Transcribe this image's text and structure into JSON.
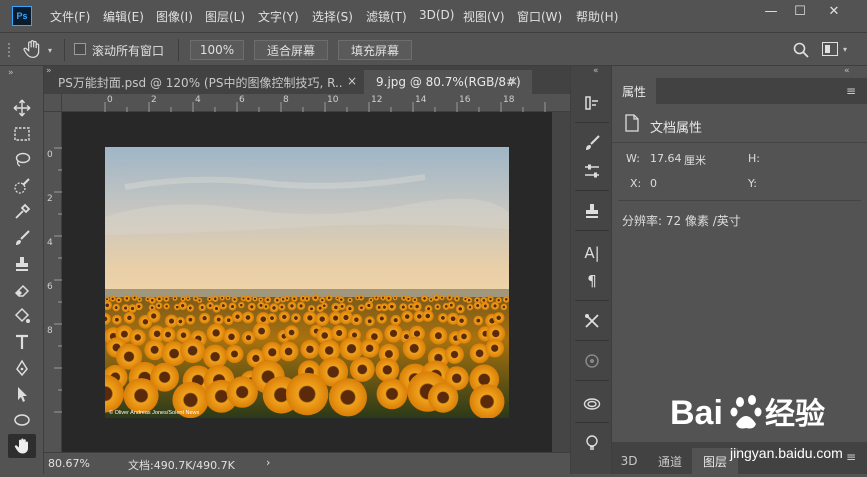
{
  "app": {
    "logo": "Ps"
  },
  "menu": [
    "文件(F)",
    "编辑(E)",
    "图像(I)",
    "图层(L)",
    "文字(Y)",
    "选择(S)",
    "滤镜(T)",
    "3D(D)",
    "视图(V)",
    "窗口(W)",
    "帮助(H)"
  ],
  "window_buttons": {
    "minimize": "—",
    "maximize": "☐",
    "close": "✕"
  },
  "options": {
    "scroll_all_label": "滚动所有窗口",
    "zoom_value": "100%",
    "fit_screen": "适合屏幕",
    "fill_screen": "填充屏幕"
  },
  "tabs": [
    {
      "label": "PS万能封面.psd @ 120% (PS中的图像控制技巧, R...",
      "close": "×"
    },
    {
      "label": "9.jpg @ 80.7%(RGB/8#)",
      "close": "×"
    }
  ],
  "ruler_top": [
    "0",
    "2",
    "4",
    "6",
    "8",
    "10",
    "12",
    "14",
    "16",
    "18"
  ],
  "ruler_left": [
    "0",
    "2",
    "4",
    "6",
    "8"
  ],
  "photo": {
    "credit": "© Oliver Andreas Jones/Solent News"
  },
  "status": {
    "zoom": "80.67%",
    "doc": "文档:490.7K/490.7K",
    "arrow": "›"
  },
  "properties": {
    "tab": "属性",
    "title": "文档属性",
    "w_label": "W:",
    "w_value": "17.64",
    "w_unit": "厘米",
    "h_label": "H:",
    "x_label": "X:",
    "x_value": "0",
    "y_label": "Y:",
    "resolution": "分辨率: 72 像素 /英寸"
  },
  "bottom_tabs": [
    "3D",
    "通道",
    "图层"
  ],
  "watermark": {
    "brand": "Bai",
    "paw": "du",
    "suffix": "经验",
    "url": "jingyan.baidu.com"
  }
}
